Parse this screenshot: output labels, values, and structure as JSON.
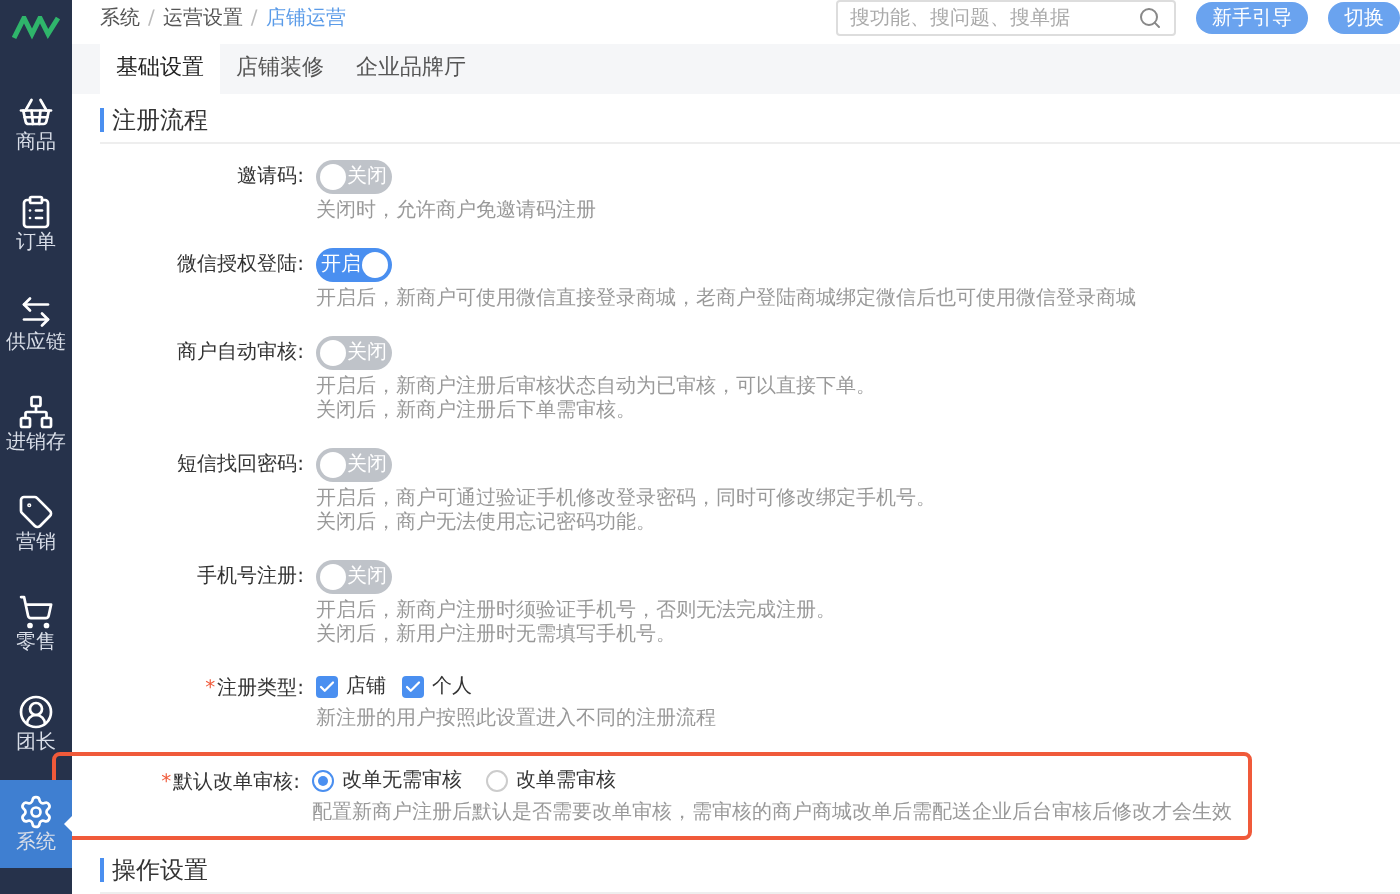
{
  "sidebar": {
    "items": [
      {
        "label": "商品",
        "selected": false
      },
      {
        "label": "订单",
        "selected": false
      },
      {
        "label": "供应链",
        "selected": false
      },
      {
        "label": "进销存",
        "selected": false
      },
      {
        "label": "营销",
        "selected": false
      },
      {
        "label": "零售",
        "selected": false
      },
      {
        "label": "团长",
        "selected": false
      },
      {
        "label": "系统",
        "selected": true
      }
    ]
  },
  "header": {
    "breadcrumb": [
      {
        "label": "系统",
        "current": false
      },
      {
        "label": "运营设置",
        "current": false
      },
      {
        "label": "店铺运营",
        "current": true
      }
    ],
    "separator": "/",
    "search": {
      "placeholder": "搜功能、搜问题、搜单据"
    },
    "buttons": [
      "新手引导",
      "切换"
    ]
  },
  "tabs": [
    {
      "label": "基础设置",
      "selected": true
    },
    {
      "label": "店铺装修",
      "selected": false
    },
    {
      "label": "企业品牌厅",
      "selected": false
    }
  ],
  "sections": [
    {
      "title": "注册流程",
      "rows": [
        {
          "kind": "toggle",
          "label": "邀请码:",
          "highlighted": false,
          "on": false,
          "toggle_text": "关闭",
          "description": [
            "关闭时，允许商户免邀请码注册"
          ]
        },
        {
          "kind": "toggle",
          "label": "微信授权登陆:",
          "highlighted": false,
          "on": true,
          "toggle_text": "开启",
          "description": [
            "开启后，新商户可使用微信直接登录商城，老商户登陆商城绑定微信后也可使用微信登录商城"
          ]
        },
        {
          "kind": "toggle",
          "label": "商户自动审核:",
          "highlighted": false,
          "on": false,
          "toggle_text": "关闭",
          "description": [
            "开启后，新商户注册后审核状态自动为已审核，可以直接下单。",
            "关闭后，新商户注册后下单需审核。"
          ]
        },
        {
          "kind": "toggle",
          "label": "短信找回密码:",
          "highlighted": false,
          "on": false,
          "toggle_text": "关闭",
          "description": [
            "开启后，商户可通过验证手机修改登录密码，同时可修改绑定手机号。",
            "关闭后，商户无法使用忘记密码功能。"
          ]
        },
        {
          "kind": "toggle",
          "label": "手机号注册:",
          "highlighted": false,
          "on": false,
          "toggle_text": "关闭",
          "description": [
            "开启后，新商户注册时须验证手机号，否则无法完成注册。",
            "关闭后，新用户注册时无需填写手机号。"
          ]
        },
        {
          "kind": "checkboxes",
          "label": "注册类型:",
          "required_mark": "*",
          "highlighted": false,
          "options": [
            {
              "label": "店铺",
              "checked": true
            },
            {
              "label": "个人",
              "checked": true
            }
          ],
          "description": [
            "新注册的用户按照此设置进入不同的注册流程"
          ]
        },
        {
          "kind": "radios",
          "label": "默认改单审核:",
          "required_mark": "*",
          "highlighted": true,
          "options": [
            {
              "label": "改单无需审核",
              "selected": true
            },
            {
              "label": "改单需审核",
              "selected": false
            }
          ],
          "description": [
            "配置新商户注册后默认是否需要改单审核，需审核的商户商城改单后需配送企业后台审核后修改才会生效"
          ]
        }
      ]
    },
    {
      "title": "操作设置"
    }
  ]
}
